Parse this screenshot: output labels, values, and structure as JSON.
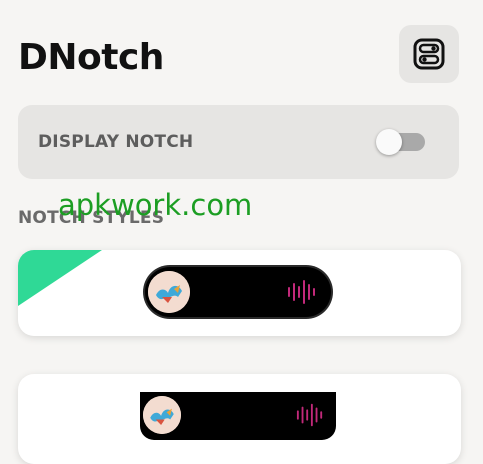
{
  "app": {
    "title": "DNotch"
  },
  "display_notch": {
    "label": "DISPLAY NOTCH",
    "enabled": false
  },
  "notch_styles": {
    "label": "NOTCH STYLES",
    "styles": [
      {
        "name": "pill",
        "selected": true,
        "accent": "#2fd996"
      },
      {
        "name": "notch",
        "selected": false
      }
    ]
  },
  "watermark": "apkwork.com",
  "colors": {
    "background": "#f6f5f3",
    "panel": "#e6e5e3",
    "accent": "#2fd996",
    "wave": "#c2297a",
    "watermark": "#1c9e23"
  },
  "icons": {
    "settings": "toggle-settings-icon",
    "album_art": "album-art-icon",
    "audio_wave": "audio-wave-icon"
  }
}
